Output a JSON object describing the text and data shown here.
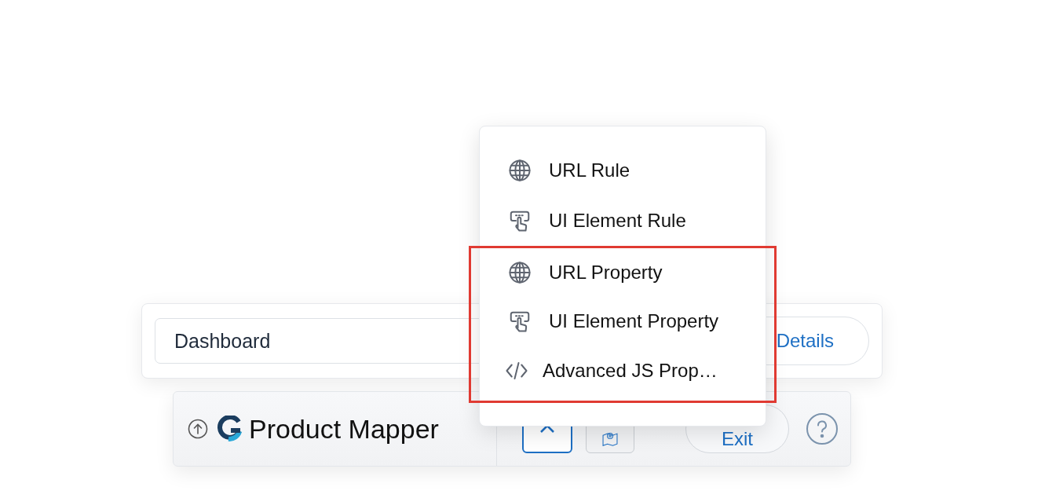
{
  "page_bar": {
    "page_name": "Dashboard",
    "details_button": "Details"
  },
  "mapper_bar": {
    "title": "Product Mapper",
    "exit_button": "Exit"
  },
  "menu": {
    "items": [
      {
        "label": "URL Rule",
        "kind": "globe",
        "highlighted": false
      },
      {
        "label": "UI Element Rule",
        "kind": "touch",
        "highlighted": false
      },
      {
        "label": "URL Property",
        "kind": "globe",
        "highlighted": true
      },
      {
        "label": "UI Element Property",
        "kind": "touch",
        "highlighted": true
      },
      {
        "label": "Advanced JS Prop…",
        "kind": "code",
        "highlighted": true
      }
    ]
  }
}
